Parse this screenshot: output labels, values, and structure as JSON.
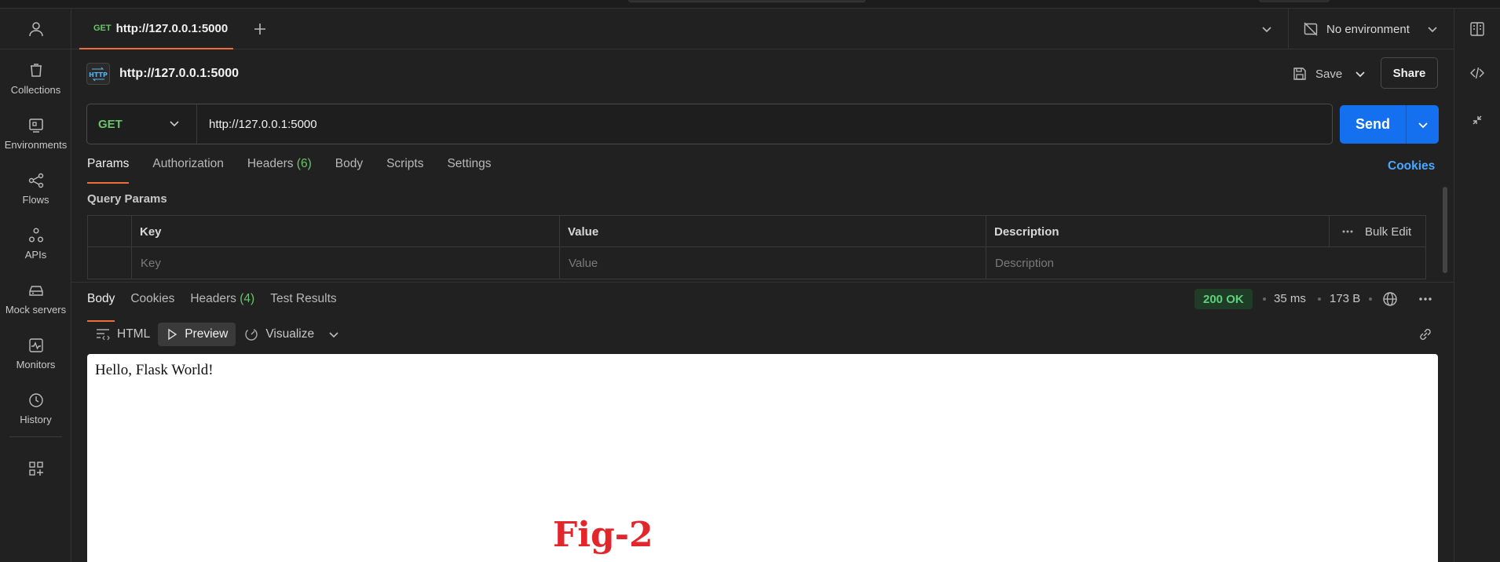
{
  "sidebar": {
    "items": [
      {
        "label": "Collections",
        "icon": "collections-icon"
      },
      {
        "label": "Environments",
        "icon": "environments-icon"
      },
      {
        "label": "Flows",
        "icon": "flows-icon"
      },
      {
        "label": "APIs",
        "icon": "apis-icon"
      },
      {
        "label": "Mock servers",
        "icon": "mock-servers-icon"
      },
      {
        "label": "Monitors",
        "icon": "monitors-icon"
      },
      {
        "label": "History",
        "icon": "history-icon"
      }
    ]
  },
  "tab": {
    "method": "GET",
    "title": "http://127.0.0.1:5000",
    "unsaved": true
  },
  "environment": {
    "label": "No environment"
  },
  "request": {
    "name": "http://127.0.0.1:5000",
    "save_label": "Save",
    "share_label": "Share",
    "method": "GET",
    "url": "http://127.0.0.1:5000",
    "send_label": "Send"
  },
  "request_tabs": [
    {
      "label": "Params",
      "active": true
    },
    {
      "label": "Authorization"
    },
    {
      "label": "Headers",
      "count": "(6)"
    },
    {
      "label": "Body"
    },
    {
      "label": "Scripts"
    },
    {
      "label": "Settings"
    }
  ],
  "cookies_link": "Cookies",
  "query_params": {
    "title": "Query Params",
    "headers": {
      "key": "Key",
      "value": "Value",
      "description": "Description",
      "bulk_edit": "Bulk Edit"
    },
    "placeholders": {
      "key": "Key",
      "value": "Value",
      "description": "Description"
    }
  },
  "response_tabs": [
    {
      "label": "Body",
      "active": true
    },
    {
      "label": "Cookies"
    },
    {
      "label": "Headers",
      "count": "(4)"
    },
    {
      "label": "Test Results"
    }
  ],
  "response_meta": {
    "status": "200 OK",
    "time": "35 ms",
    "size": "173 B",
    "status_color": "#5fd07a"
  },
  "body_formats": [
    {
      "label": "HTML"
    },
    {
      "label": "Preview",
      "active": true
    },
    {
      "label": "Visualize"
    }
  ],
  "preview_text": "Hello, Flask World!",
  "figure_label": "Fig-2",
  "colors": {
    "accent": "#f26b3a",
    "send": "#1570ef",
    "method_get": "#6bc46b",
    "link": "#4aa8ff",
    "figure_label": "#e3262b"
  }
}
